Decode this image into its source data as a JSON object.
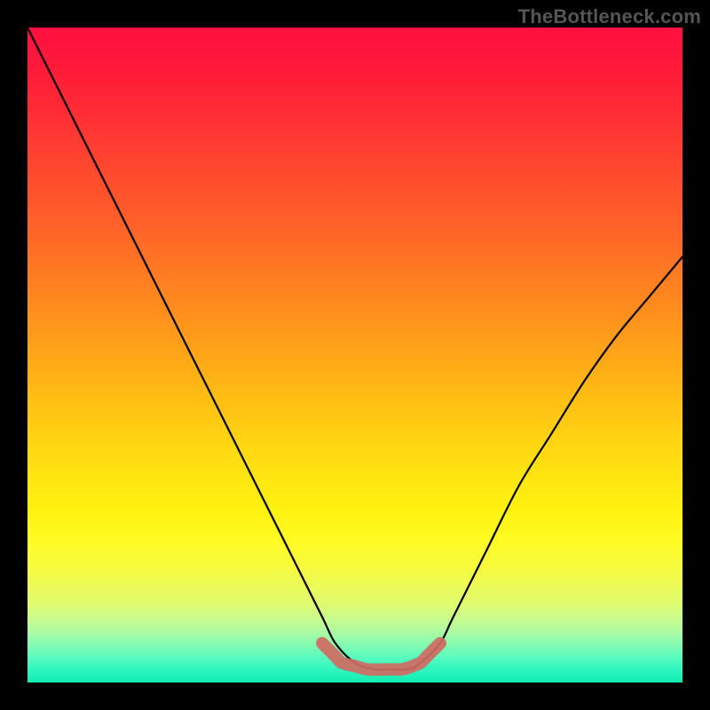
{
  "watermark": "TheBottleneck.com",
  "chart_data": {
    "type": "line",
    "title": "",
    "xlabel": "",
    "ylabel": "",
    "xlim": [
      0,
      100
    ],
    "ylim": [
      0,
      100
    ],
    "grid": false,
    "series": [
      {
        "name": "bottleneck-curve",
        "color": "#000000",
        "x": [
          0,
          5,
          10,
          15,
          20,
          25,
          30,
          35,
          40,
          45,
          47,
          50,
          53,
          55,
          58,
          60,
          63,
          65,
          70,
          75,
          80,
          85,
          90,
          95,
          100
        ],
        "y": [
          100,
          90,
          80,
          70,
          60,
          50,
          40,
          30,
          20,
          10,
          6,
          3,
          2,
          2,
          2,
          3,
          6,
          10,
          20,
          30,
          38,
          46,
          53,
          59,
          65
        ]
      },
      {
        "name": "optimal-band",
        "color": "#d06a62",
        "x": [
          45,
          47,
          48,
          50,
          52,
          55,
          57,
          58,
          59,
          60,
          61,
          62,
          63
        ],
        "y": [
          6,
          4,
          3,
          2.5,
          2,
          2,
          2,
          2.2,
          2.6,
          3,
          4,
          5,
          6
        ]
      }
    ],
    "gradient_stops": [
      {
        "pos": 0,
        "color": "#ff1040"
      },
      {
        "pos": 50,
        "color": "#ffa518"
      },
      {
        "pos": 78,
        "color": "#fffb22"
      },
      {
        "pos": 100,
        "color": "#10eeb2"
      }
    ]
  }
}
